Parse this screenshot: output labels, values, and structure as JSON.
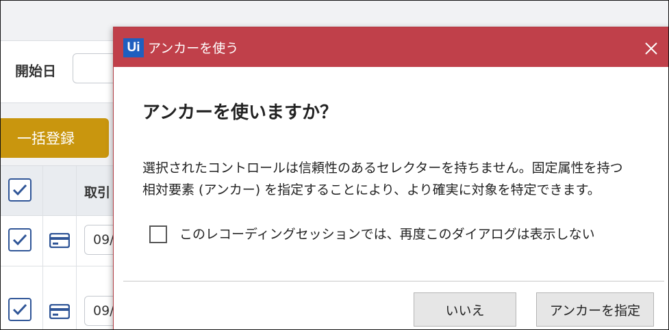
{
  "background_app": {
    "filter": {
      "start_date_label": "開始日",
      "start_date_value": ""
    },
    "bulk_register_label": "一括登録",
    "grid": {
      "header_partial_label": "取引",
      "rows": [
        {
          "checked": true,
          "date_partial": "09/"
        },
        {
          "checked": true,
          "date_partial": "09/"
        }
      ]
    },
    "colors": {
      "bulk_button": "#c9960e",
      "checkbox": "#2f5597",
      "card_icon": "#2f5597"
    }
  },
  "dialog": {
    "logo_text": "Ui",
    "title": "アンカーを使う",
    "heading": "アンカーを使いますか？",
    "message_line1": "選択されたコントロールは信頼性のあるセレクターを持ちません。固定属性を持つ",
    "message_line2": "相対要素 (アンカー) を指定することにより、より確実に対象を特定できます。",
    "checkbox_label": "このレコーディングセッションでは、再度このダイアログは表示しない",
    "checkbox_checked": false,
    "no_button_label": "いいえ",
    "yes_button_label": "アンカーを指定",
    "close_icon": "close-icon",
    "colors": {
      "titlebar": "#c0404a",
      "logo_bg": "#1f5fbf"
    }
  }
}
